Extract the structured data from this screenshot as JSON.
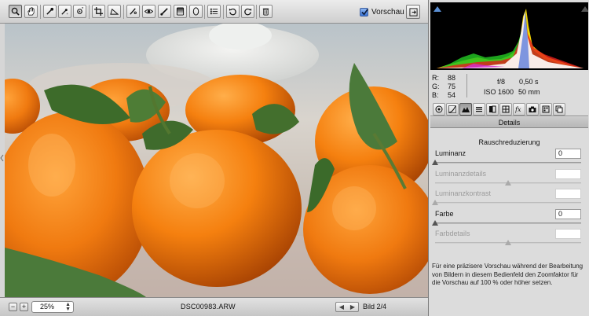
{
  "toolbar": {
    "tools": [
      "zoom-tool",
      "hand-tool",
      "white-balance-tool",
      "color-sampler-tool",
      "target-adjustment-tool",
      "crop-tool",
      "straighten-tool",
      "spot-removal-tool",
      "red-eye-tool",
      "adjustment-brush-tool",
      "graduated-filter-tool",
      "radial-filter-tool",
      "preferences-tool",
      "rotate-left-tool",
      "rotate-right-tool",
      "trash-tool"
    ],
    "preview_label": "Vorschau",
    "preview_checked": true
  },
  "status": {
    "zoom_out": "−",
    "zoom_in": "+",
    "zoom_value": "25%",
    "filename": "DSC00983.ARW",
    "image_count": "Bild 2/4"
  },
  "readout": {
    "r_label": "R:",
    "r_value": "88",
    "g_label": "G:",
    "g_value": "75",
    "b_label": "B:",
    "b_value": "54",
    "aperture": "f/8",
    "shutter": "0,50 s",
    "iso": "ISO 1600",
    "focal": "50 mm"
  },
  "panel": {
    "title": "Details",
    "section": "Rauschreduzierung",
    "sliders": [
      {
        "label": "Luminanz",
        "value": "0",
        "enabled": true,
        "level": 0
      },
      {
        "label": "Luminanzdetails",
        "value": "",
        "enabled": false,
        "level": 0.5
      },
      {
        "label": "Luminanzkontrast",
        "value": "",
        "enabled": false,
        "level": 0
      },
      {
        "label": "Farbe",
        "value": "0",
        "enabled": true,
        "level": 0
      },
      {
        "label": "Farbdetails",
        "value": "",
        "enabled": false,
        "level": 0.5
      }
    ],
    "info": "Für eine präzisere Vorschau während der Bearbeitung von Bildern in diesem Bedienfeld den Zoomfaktor für die Vorschau auf 100 % oder höher setzen."
  },
  "colors": {
    "orange": "#f07a10",
    "leaf": "#3d6b2a",
    "accent_blue": "#3a74d6"
  }
}
